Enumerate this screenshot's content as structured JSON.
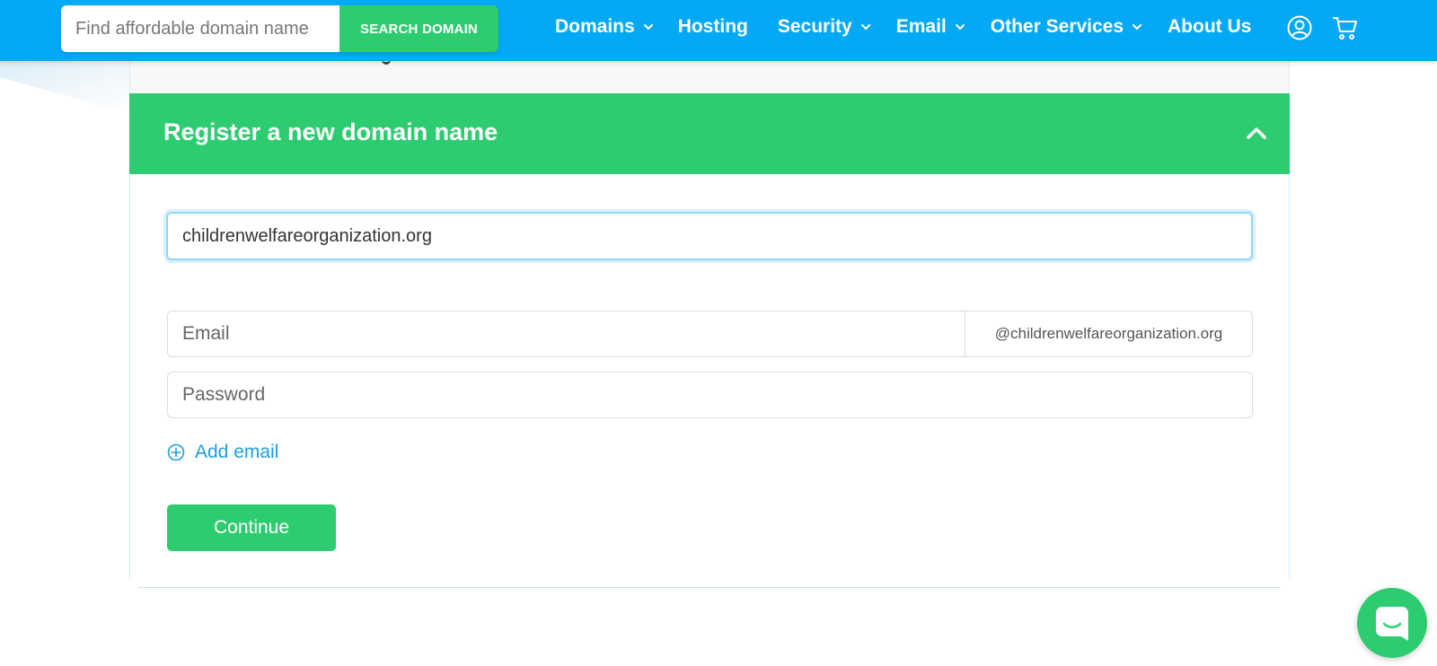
{
  "header": {
    "search": {
      "placeholder": "Find affordable domain name",
      "button_label": "SEARCH DOMAIN"
    },
    "nav": [
      {
        "label": "Domains",
        "has_dropdown": true
      },
      {
        "label": "Hosting",
        "has_dropdown": false
      },
      {
        "label": "Security",
        "has_dropdown": true
      },
      {
        "label": "Email",
        "has_dropdown": true
      },
      {
        "label": "Other Services",
        "has_dropdown": true
      },
      {
        "label": "About Us",
        "has_dropdown": false
      }
    ],
    "icons": [
      "user-icon",
      "cart-icon"
    ]
  },
  "card": {
    "title": "Register a new domain name",
    "expanded": true,
    "domain_input_value": "childrenwelfareorganization.org",
    "email": {
      "placeholder": "Email",
      "suffix": "@childrenwelfareorganization.org"
    },
    "password": {
      "placeholder": "Password"
    },
    "add_email_label": "Add email",
    "continue_label": "Continue"
  },
  "colors": {
    "header_blue": "#03a9f4",
    "accent_green": "#2ecc71",
    "link_blue": "#1a9fe0"
  },
  "chat": {
    "icon": "chat-icon"
  }
}
